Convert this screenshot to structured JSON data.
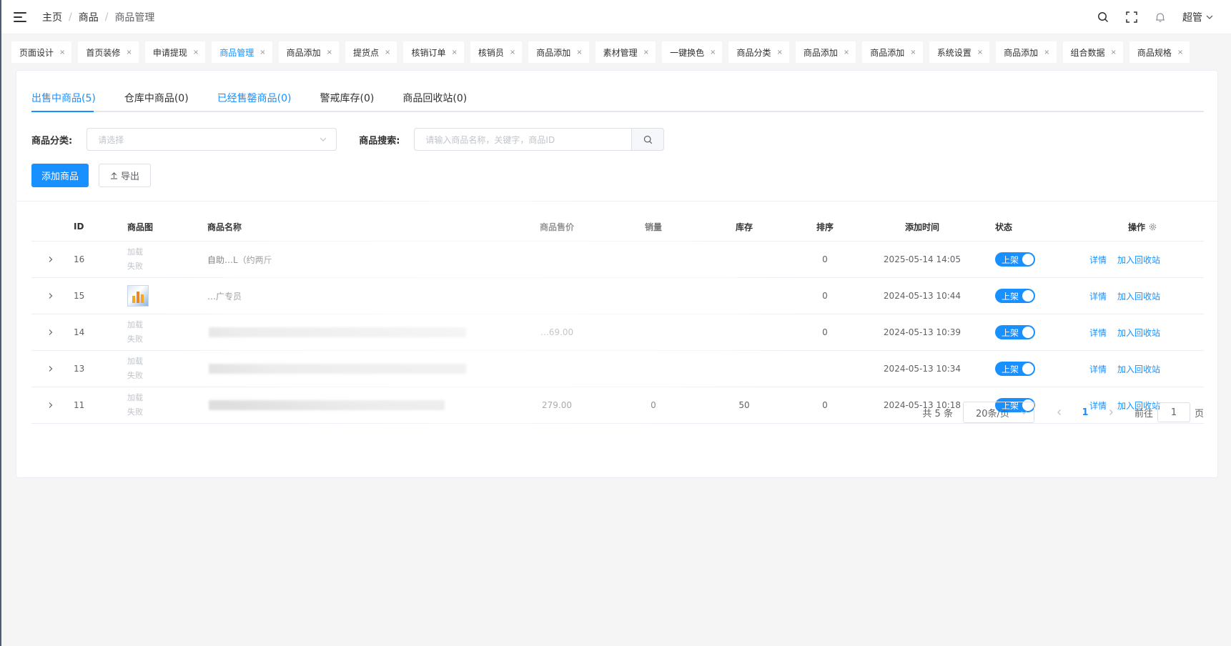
{
  "header": {
    "breadcrumb": [
      "主页",
      "商品",
      "商品管理"
    ],
    "user_name": "超管"
  },
  "tags": [
    {
      "label": "页面设计",
      "active": false
    },
    {
      "label": "首页装修",
      "active": false
    },
    {
      "label": "申请提现",
      "active": false
    },
    {
      "label": "商品管理",
      "active": true
    },
    {
      "label": "商品添加",
      "active": false
    },
    {
      "label": "提货点",
      "active": false
    },
    {
      "label": "核销订单",
      "active": false
    },
    {
      "label": "核销员",
      "active": false
    },
    {
      "label": "商品添加",
      "active": false
    },
    {
      "label": "素材管理",
      "active": false
    },
    {
      "label": "一键换色",
      "active": false
    },
    {
      "label": "商品分类",
      "active": false
    },
    {
      "label": "商品添加",
      "active": false
    },
    {
      "label": "商品添加",
      "active": false
    },
    {
      "label": "系统设置",
      "active": false
    },
    {
      "label": "商品添加",
      "active": false
    },
    {
      "label": "组合数据",
      "active": false
    },
    {
      "label": "商品规格",
      "active": false
    }
  ],
  "tabs": [
    {
      "label": "出售中商品(5)",
      "active": true
    },
    {
      "label": "仓库中商品(0)",
      "active": false
    },
    {
      "label": "已经售罄商品(0)",
      "active": false,
      "highlight": true
    },
    {
      "label": "警戒库存(0)",
      "active": false
    },
    {
      "label": "商品回收站(0)",
      "active": false
    }
  ],
  "filters": {
    "category_label": "商品分类:",
    "category_placeholder": "请选择",
    "search_label": "商品搜索:",
    "search_placeholder": "请输入商品名称，关键字，商品ID"
  },
  "buttons": {
    "add": "添加商品",
    "export": "导出"
  },
  "table": {
    "columns": {
      "id": "ID",
      "image": "商品图",
      "name": "商品名称",
      "price": "商品售价",
      "sales": "销量",
      "stock": "库存",
      "sort": "排序",
      "time": "添加时间",
      "status": "状态",
      "ops": "操作"
    },
    "rows": [
      {
        "id": "16",
        "image": "加载失败",
        "name": "自助…L（约两斤",
        "price": "",
        "sales": "",
        "stock": "",
        "sort": "0",
        "time": "2025-05-14 14:05",
        "status": "上架"
      },
      {
        "id": "15",
        "image": "thumbnail",
        "name": "…广专员",
        "price": "",
        "sales": "",
        "stock": "",
        "sort": "0",
        "time": "2024-05-13 10:44",
        "status": "上架"
      },
      {
        "id": "14",
        "image": "加载失败",
        "name": "",
        "price": "…69.00",
        "sales": "",
        "stock": "",
        "sort": "0",
        "time": "2024-05-13 10:39",
        "status": "上架"
      },
      {
        "id": "13",
        "image": "加载失败",
        "name": "",
        "price": "",
        "sales": "",
        "stock": "",
        "sort": "",
        "time": "2024-05-13 10:34",
        "status": "上架"
      },
      {
        "id": "11",
        "image": "加载失败",
        "name": "",
        "price": "279.00",
        "sales": "0",
        "stock": "50",
        "sort": "0",
        "time": "2024-05-13 10:18",
        "status": "上架"
      }
    ],
    "op_detail": "详情",
    "op_recycle": "加入回收站"
  },
  "pagination": {
    "total": "共 5 条",
    "page_size": "20条/页",
    "current": "1",
    "goto_prefix": "前往",
    "goto_value": "1",
    "goto_suffix": "页"
  },
  "colors": {
    "primary": "#1890ff",
    "sidebar_edge": "#4d5b78"
  }
}
